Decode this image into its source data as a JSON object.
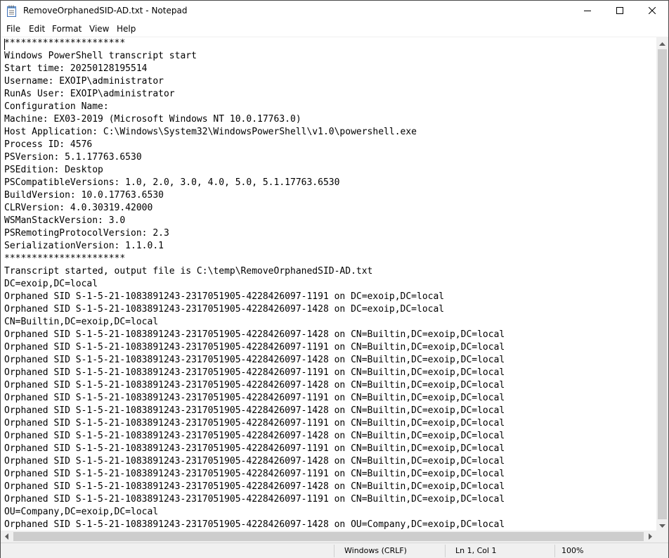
{
  "window": {
    "title": "RemoveOrphanedSID-AD.txt - Notepad"
  },
  "icons": {
    "app": "notepad-icon",
    "minimize": "minimize-icon",
    "maximize": "maximize-icon",
    "close": "close-icon"
  },
  "menu": {
    "file": "File",
    "edit": "Edit",
    "format": "Format",
    "view": "View",
    "help": "Help"
  },
  "editor": {
    "lines": [
      "**********************",
      "Windows PowerShell transcript start",
      "Start time: 20250128195514",
      "Username: EXOIP\\administrator",
      "RunAs User: EXOIP\\administrator",
      "Configuration Name: ",
      "Machine: EX03-2019 (Microsoft Windows NT 10.0.17763.0)",
      "Host Application: C:\\Windows\\System32\\WindowsPowerShell\\v1.0\\powershell.exe",
      "Process ID: 4576",
      "PSVersion: 5.1.17763.6530",
      "PSEdition: Desktop",
      "PSCompatibleVersions: 1.0, 2.0, 3.0, 4.0, 5.0, 5.1.17763.6530",
      "BuildVersion: 10.0.17763.6530",
      "CLRVersion: 4.0.30319.42000",
      "WSManStackVersion: 3.0",
      "PSRemotingProtocolVersion: 2.3",
      "SerializationVersion: 1.1.0.1",
      "**********************",
      "Transcript started, output file is C:\\temp\\RemoveOrphanedSID-AD.txt",
      "DC=exoip,DC=local",
      "Orphaned SID S-1-5-21-1083891243-2317051905-4228426097-1191 on DC=exoip,DC=local",
      "Orphaned SID S-1-5-21-1083891243-2317051905-4228426097-1428 on DC=exoip,DC=local",
      "CN=Builtin,DC=exoip,DC=local",
      "Orphaned SID S-1-5-21-1083891243-2317051905-4228426097-1428 on CN=Builtin,DC=exoip,DC=local",
      "Orphaned SID S-1-5-21-1083891243-2317051905-4228426097-1191 on CN=Builtin,DC=exoip,DC=local",
      "Orphaned SID S-1-5-21-1083891243-2317051905-4228426097-1428 on CN=Builtin,DC=exoip,DC=local",
      "Orphaned SID S-1-5-21-1083891243-2317051905-4228426097-1191 on CN=Builtin,DC=exoip,DC=local",
      "Orphaned SID S-1-5-21-1083891243-2317051905-4228426097-1428 on CN=Builtin,DC=exoip,DC=local",
      "Orphaned SID S-1-5-21-1083891243-2317051905-4228426097-1191 on CN=Builtin,DC=exoip,DC=local",
      "Orphaned SID S-1-5-21-1083891243-2317051905-4228426097-1428 on CN=Builtin,DC=exoip,DC=local",
      "Orphaned SID S-1-5-21-1083891243-2317051905-4228426097-1191 on CN=Builtin,DC=exoip,DC=local",
      "Orphaned SID S-1-5-21-1083891243-2317051905-4228426097-1428 on CN=Builtin,DC=exoip,DC=local",
      "Orphaned SID S-1-5-21-1083891243-2317051905-4228426097-1191 on CN=Builtin,DC=exoip,DC=local",
      "Orphaned SID S-1-5-21-1083891243-2317051905-4228426097-1428 on CN=Builtin,DC=exoip,DC=local",
      "Orphaned SID S-1-5-21-1083891243-2317051905-4228426097-1191 on CN=Builtin,DC=exoip,DC=local",
      "Orphaned SID S-1-5-21-1083891243-2317051905-4228426097-1428 on CN=Builtin,DC=exoip,DC=local",
      "Orphaned SID S-1-5-21-1083891243-2317051905-4228426097-1191 on CN=Builtin,DC=exoip,DC=local",
      "OU=Company,DC=exoip,DC=local",
      "Orphaned SID S-1-5-21-1083891243-2317051905-4228426097-1428 on OU=Company,DC=exoip,DC=local"
    ]
  },
  "status": {
    "encoding": "Windows (CRLF)",
    "position": "Ln 1, Col 1",
    "zoom": "100%"
  },
  "colors": {
    "border": "#4a4a4a",
    "scrollbar_track": "#f0f0f0",
    "scrollbar_thumb": "#cdcdcd",
    "statusbar": "#f0f0f0"
  }
}
